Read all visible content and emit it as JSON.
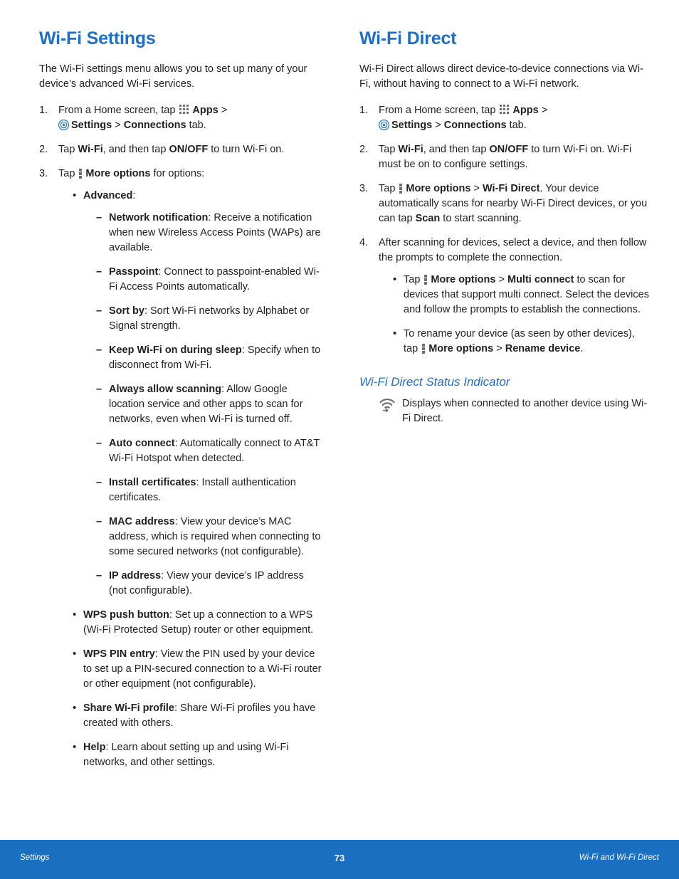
{
  "colors": {
    "heading": "#1f6fc4",
    "footer_bg": "#1a6fc0",
    "text": "#231f20"
  },
  "left": {
    "title": "Wi-Fi Settings",
    "intro": "The Wi-Fi settings menu allows you to set up many of your device’s advanced Wi-Fi services.",
    "steps": [
      {
        "num": "1.",
        "pre": "From a Home screen, tap ",
        "apps": "Apps",
        "mid": " > ",
        "settings": "Settings",
        "mid2": " > ",
        "connections": "Connections",
        "post": " tab."
      },
      {
        "num": "2.",
        "text_a": "Tap ",
        "b1": "Wi-Fi",
        "text_b": ", and then tap ",
        "b2": "ON/OFF",
        "text_c": " to turn Wi-Fi on."
      },
      {
        "num": "3.",
        "text_a": "Tap ",
        "b1": "More options",
        "text_b": " for options:"
      }
    ],
    "advanced_label": "Advanced",
    "advanced_items": [
      {
        "term": "Network notification",
        "desc": ": Receive a notification when new Wireless Access Points (WAPs) are available."
      },
      {
        "term": "Passpoint",
        "desc": ": Connect to passpoint-enabled Wi-Fi Access Points automatically."
      },
      {
        "term": "Sort by",
        "desc": ": Sort Wi-Fi networks by Alphabet or Signal strength."
      },
      {
        "term": "Keep Wi-Fi on during sleep",
        "desc": ": Specify when to disconnect from Wi-Fi."
      },
      {
        "term": "Always allow scanning",
        "desc": ": Allow Google location service and other apps to scan for networks, even when Wi-Fi is turned off."
      },
      {
        "term": "Auto connect",
        "desc": ": Automatically connect to AT&T Wi-Fi Hotspot when detected."
      },
      {
        "term": "Install certificates",
        "desc": ": Install authentication certificates."
      },
      {
        "term": "MAC address",
        "desc": ": View your device’s MAC address, which is required when connecting to some secured networks (not configurable)."
      },
      {
        "term": "IP address",
        "desc": ": View your device’s IP address (not configurable)."
      }
    ],
    "other_options": [
      {
        "term": "WPS push button",
        "desc": ": Set up a connection to a WPS (Wi-Fi Protected Setup) router or other equipment."
      },
      {
        "term": "WPS PIN entry",
        "desc": ": View the PIN used by your device to set up a PIN-secured connection to a Wi-Fi router or other equipment (not configurable)."
      },
      {
        "term": "Share Wi-Fi profile",
        "desc": ": Share Wi-Fi profiles you have created with others."
      },
      {
        "term": "Help",
        "desc": ": Learn about setting up and using Wi-Fi networks, and other settings."
      }
    ]
  },
  "right": {
    "title": "Wi-Fi Direct",
    "intro": "Wi-Fi Direct allows direct device-to-device connections via Wi-Fi, without having to connect to a Wi-Fi network.",
    "step1": {
      "num": "1.",
      "pre": "From a Home screen, tap ",
      "apps": "Apps",
      "mid": " > ",
      "settings": "Settings",
      "mid2": " > ",
      "connections": "Connections",
      "post": " tab."
    },
    "step2": {
      "num": "2.",
      "text_a": "Tap ",
      "b1": "Wi-Fi",
      "text_b": ", and then tap ",
      "b2": "ON/OFF",
      "text_c": " to turn Wi-Fi on. Wi-Fi must be on to configure settings."
    },
    "step3": {
      "num": "3.",
      "text_a": "Tap ",
      "b1": "More options",
      "text_b": " > ",
      "b2": "Wi-Fi Direct",
      "text_c": ". Your device automatically scans for nearby Wi-Fi Direct devices, or you can tap ",
      "b3": "Scan",
      "text_d": " to start scanning."
    },
    "step4": {
      "num": "4.",
      "text": "After scanning for devices, select a device, and then follow the prompts to complete the connection."
    },
    "step4_bullets": [
      {
        "text_a": "Tap ",
        "b1": "More options",
        "text_b": " > ",
        "b2": "Multi connect",
        "text_c": " to scan for devices that support multi connect. Select the devices and follow the prompts to establish the connections."
      },
      {
        "text_a": "To rename your device (as seen by other devices), tap ",
        "b1": "More options",
        "text_b": " > ",
        "b2": "Rename device",
        "text_c": "."
      }
    ],
    "status_heading": "Wi-Fi Direct Status Indicator",
    "status_text": "Displays when connected to another device using Wi-Fi Direct."
  },
  "footer": {
    "left": "Settings",
    "page": "73",
    "right": "Wi-Fi and Wi-Fi Direct"
  }
}
